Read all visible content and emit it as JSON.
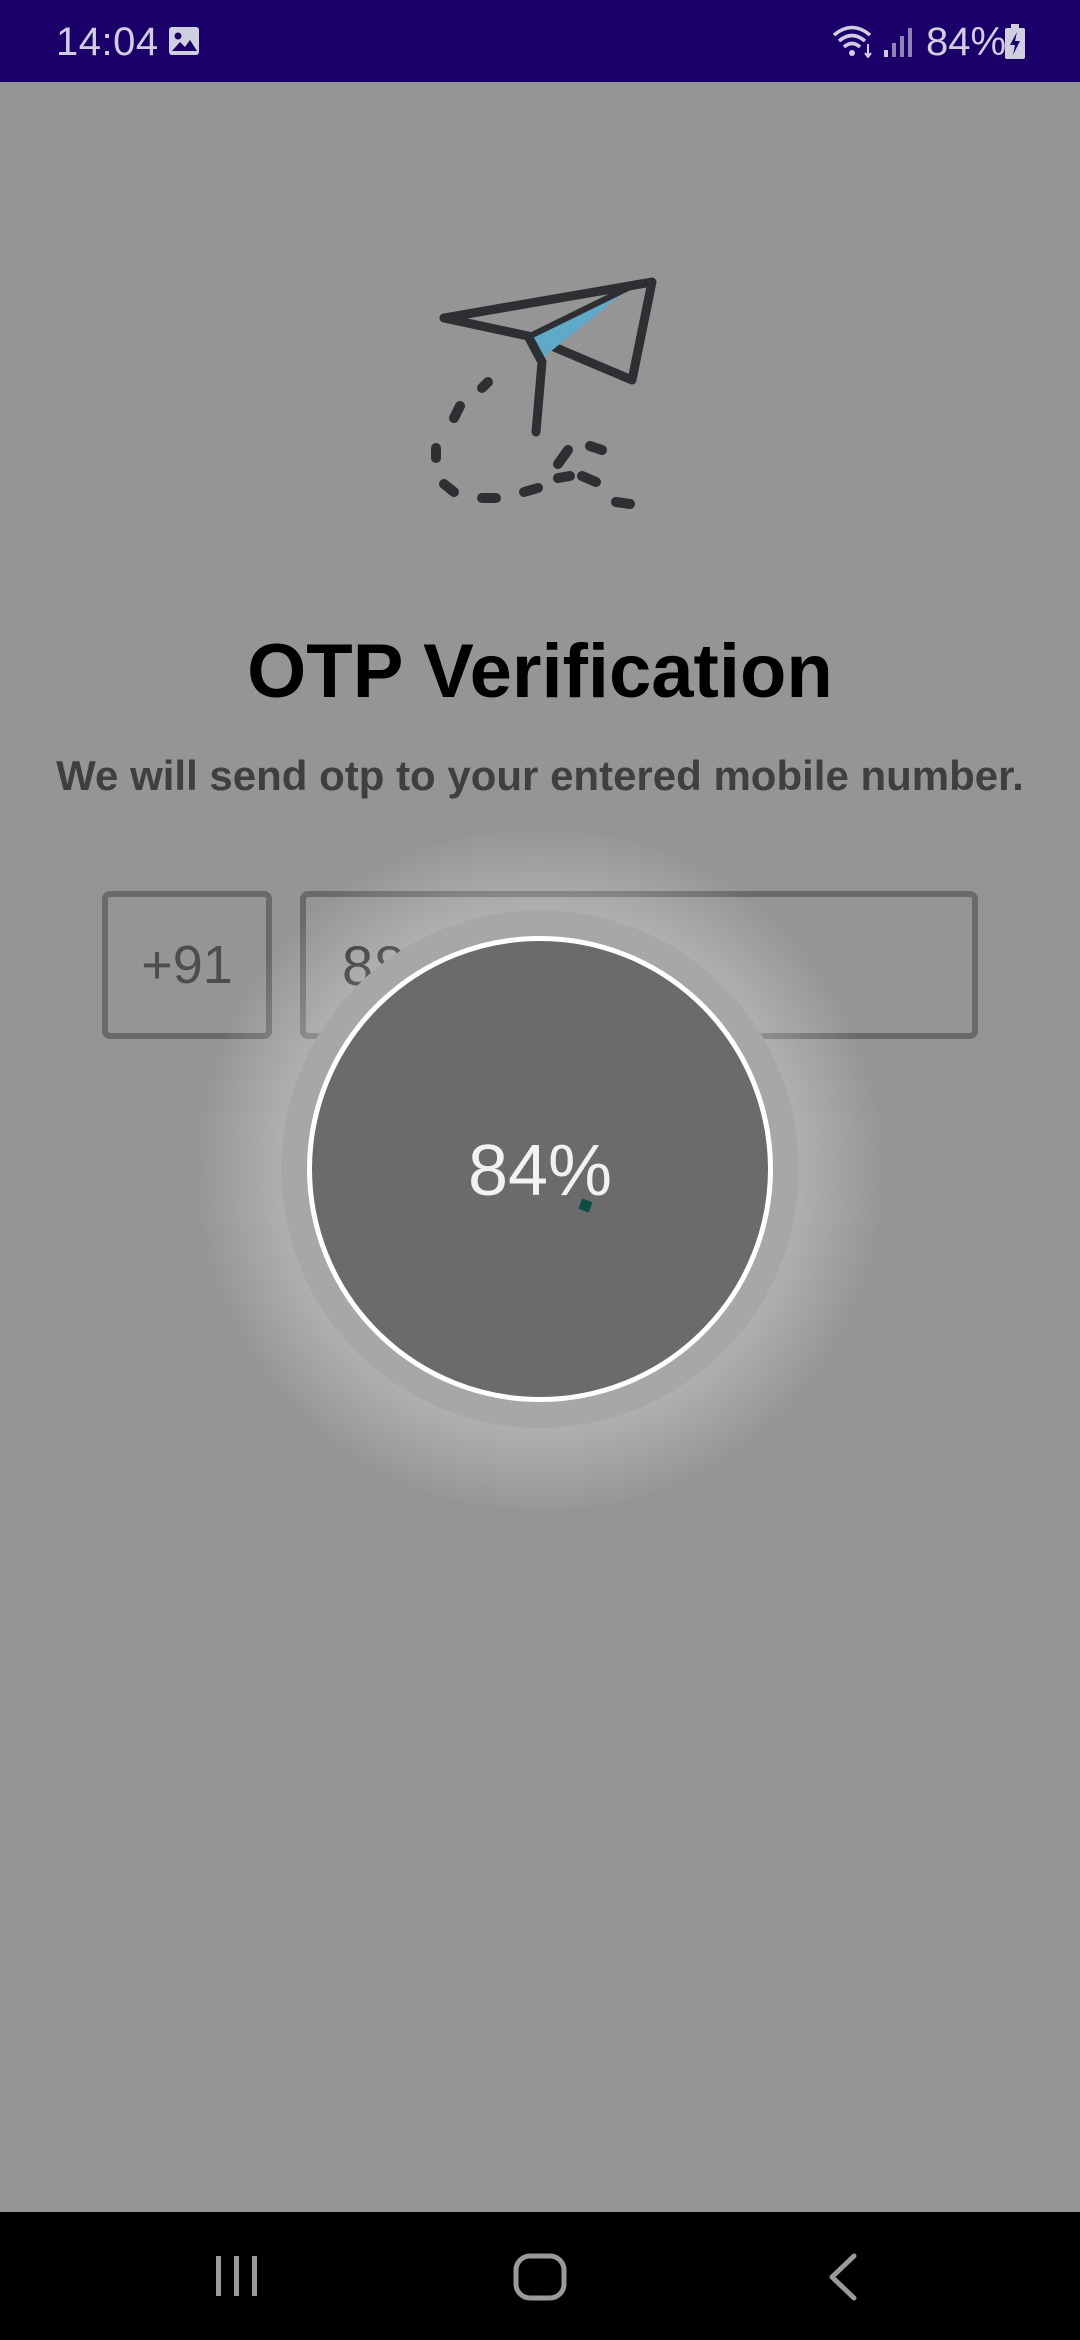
{
  "status_bar": {
    "time": "14:04",
    "battery": "84%",
    "icons": [
      "gallery-icon",
      "wifi-icon",
      "signal-icon",
      "battery-charging-icon"
    ]
  },
  "illustration": {
    "icon": "paper-plane-icon"
  },
  "header": {
    "title": "OTP Verification",
    "subtitle": "We will send otp to your entered mobile number."
  },
  "form": {
    "country_code": "+91",
    "phone_number": "8856066588"
  },
  "progress": {
    "label": "84%",
    "value": 0.84
  },
  "nav_bar": {
    "icons": [
      "recents-icon",
      "home-icon",
      "back-icon"
    ]
  },
  "colors": {
    "status_bar": "#1c006a",
    "overlay_background": "#959595",
    "plane_accent": "#5fa9c9"
  }
}
